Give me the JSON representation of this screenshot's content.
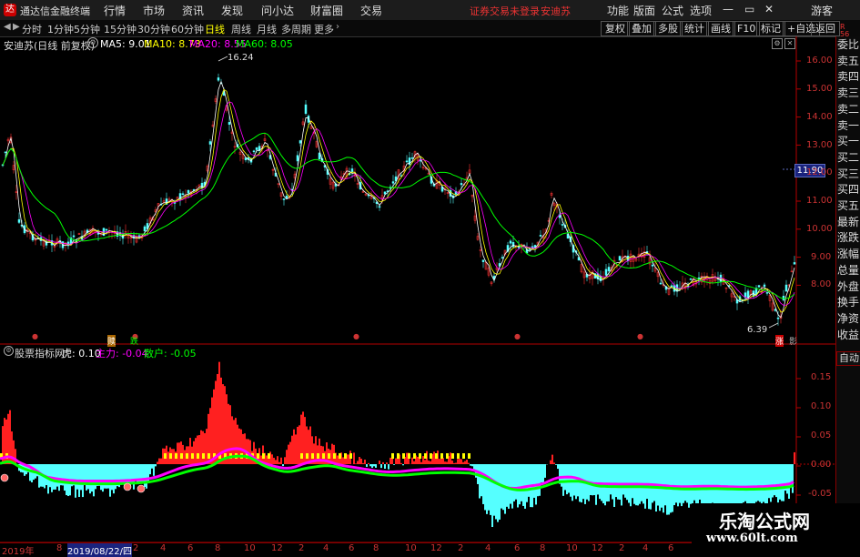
{
  "app": {
    "title": "通达信金融终端"
  },
  "menu": {
    "items": [
      "行情",
      "市场",
      "资讯",
      "发现",
      "问小达",
      "财富圈",
      "交易"
    ],
    "right": [
      "功能",
      "版面",
      "公式",
      "选项"
    ],
    "guest": "游客",
    "login_warning": "证券交易未登录",
    "stock_name": "安迪苏"
  },
  "toolbar": {
    "periods": [
      "分时",
      "1分钟",
      "5分钟",
      "15分钟",
      "30分钟",
      "60分钟",
      "日线",
      "周线",
      "月线",
      "多周期",
      "更多"
    ],
    "active": "日线",
    "right_buttons": [
      "复权",
      "叠加",
      "多股",
      "统计",
      "画线",
      "F10",
      "标记",
      "+自选",
      "返回"
    ]
  },
  "main_chart": {
    "title": "安迪苏(日线 前复权)",
    "ma": [
      {
        "label": "MA5: 9.01",
        "color": "#ffffff"
      },
      {
        "label": "MA10: 8.73",
        "color": "#ffff00"
      },
      {
        "label": "MA20: 8.55",
        "color": "#ff00ff"
      },
      {
        "label": "MA60: 8.05",
        "color": "#00ff00"
      }
    ],
    "high_label": "16.24",
    "low_label": "6.39",
    "current_price": "11.90",
    "yticks": [
      "16.00",
      "15.00",
      "14.00",
      "13.00",
      "12.00",
      "11.00",
      "10.00",
      "9.00",
      "8.00"
    ],
    "markers": [
      "赎",
      "跌",
      "涨",
      "影"
    ]
  },
  "sub_chart": {
    "title": "股票指标网",
    "values": [
      {
        "label": "虎: 0.10",
        "color": "#ffffff"
      },
      {
        "label": "主力: -0.04",
        "color": "#ff00ff"
      },
      {
        "label": "散户: -0.05",
        "color": "#00ff00"
      }
    ],
    "yticks": [
      "0.15",
      "0.10",
      "0.05",
      "0.00",
      "-0.05"
    ]
  },
  "xaxis": {
    "labels": [
      "2019年",
      "8",
      "2019/08/22/四",
      "2",
      "4",
      "6",
      "8",
      "10",
      "12",
      "2",
      "4",
      "6",
      "8",
      "10",
      "12",
      "2",
      "4",
      "6",
      "8",
      "10",
      "12",
      "2",
      "4",
      "6"
    ]
  },
  "right_panel": {
    "items": [
      "委比",
      "卖五",
      "卖四",
      "卖三",
      "卖二",
      "卖一",
      "买一",
      "买二",
      "买三",
      "买四",
      "买五",
      "最新",
      "涨跌",
      "涨幅",
      "总量",
      "外盘",
      "换手",
      "净资",
      "收益"
    ],
    "auto": "自动"
  },
  "watermark": {
    "line1": "乐淘公式网",
    "line2": "www.60lt.com"
  },
  "colors": {
    "up": "#ff3232",
    "down": "#54ffff",
    "ma5": "#ffffff",
    "ma10": "#ffff00",
    "ma20": "#ff00ff",
    "ma60": "#00ff00",
    "axis": "#b40000"
  }
}
